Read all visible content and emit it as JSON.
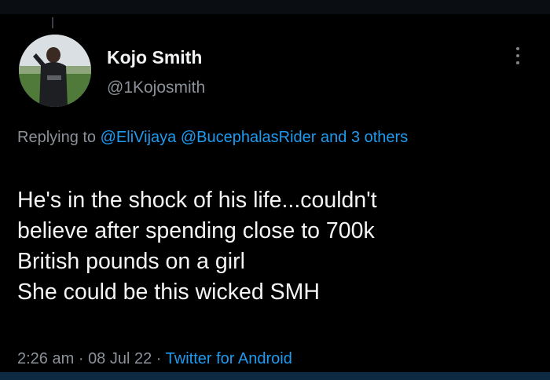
{
  "tweet": {
    "author_name": "Kojo Smith",
    "author_handle": "@1Kojosmith",
    "reply_prefix": "Replying to",
    "reply_mention_1": "@EliVijaya",
    "reply_mention_2": "@BucephalasRider",
    "reply_others": "and 3 others",
    "body_lines": [
      "He's in the shock of his life...couldn't",
      "believe after spending close to 700k",
      "British pounds on a girl",
      "She could be this wicked SMH"
    ],
    "time": "2:26 am",
    "separator": "·",
    "date": "08 Jul 22",
    "source": "Twitter for Android"
  },
  "icons": {
    "more": "more-vertical-icon",
    "avatar": "avatar"
  },
  "colors": {
    "background": "#000000",
    "text_primary": "#f4f5f6",
    "text_secondary": "#8a9199",
    "link": "#1d9bf0"
  }
}
